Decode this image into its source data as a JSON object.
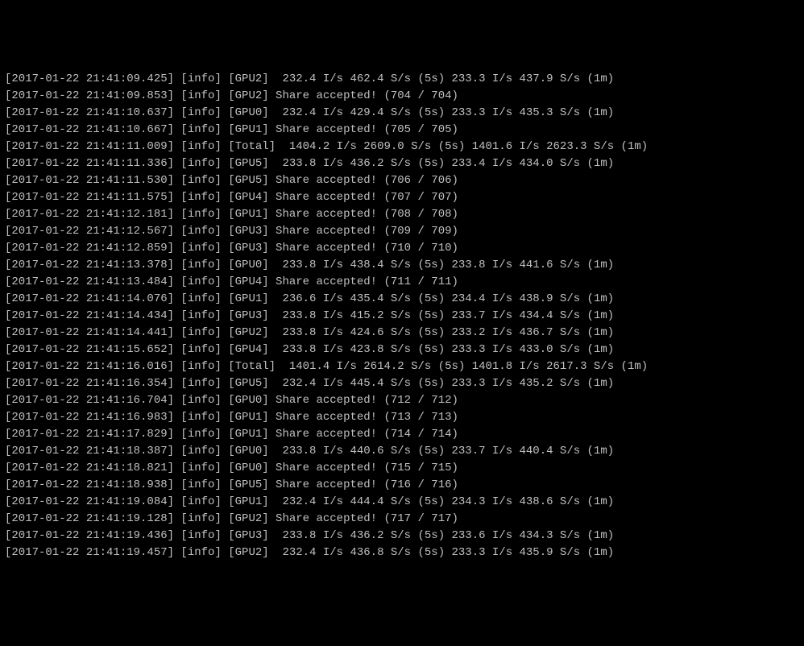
{
  "lines": [
    "[2017-01-22 21:41:09.425] [info] [GPU2]  232.4 I/s 462.4 S/s (5s) 233.3 I/s 437.9 S/s (1m)",
    "[2017-01-22 21:41:09.853] [info] [GPU2] Share accepted! (704 / 704)",
    "[2017-01-22 21:41:10.637] [info] [GPU0]  232.4 I/s 429.4 S/s (5s) 233.3 I/s 435.3 S/s (1m)",
    "[2017-01-22 21:41:10.667] [info] [GPU1] Share accepted! (705 / 705)",
    "[2017-01-22 21:41:11.009] [info] [Total]  1404.2 I/s 2609.0 S/s (5s) 1401.6 I/s 2623.3 S/s (1m)",
    "[2017-01-22 21:41:11.336] [info] [GPU5]  233.8 I/s 436.2 S/s (5s) 233.4 I/s 434.0 S/s (1m)",
    "[2017-01-22 21:41:11.530] [info] [GPU5] Share accepted! (706 / 706)",
    "[2017-01-22 21:41:11.575] [info] [GPU4] Share accepted! (707 / 707)",
    "[2017-01-22 21:41:12.181] [info] [GPU1] Share accepted! (708 / 708)",
    "[2017-01-22 21:41:12.567] [info] [GPU3] Share accepted! (709 / 709)",
    "[2017-01-22 21:41:12.859] [info] [GPU3] Share accepted! (710 / 710)",
    "[2017-01-22 21:41:13.378] [info] [GPU0]  233.8 I/s 438.4 S/s (5s) 233.8 I/s 441.6 S/s (1m)",
    "[2017-01-22 21:41:13.484] [info] [GPU4] Share accepted! (711 / 711)",
    "[2017-01-22 21:41:14.076] [info] [GPU1]  236.6 I/s 435.4 S/s (5s) 234.4 I/s 438.9 S/s (1m)",
    "[2017-01-22 21:41:14.434] [info] [GPU3]  233.8 I/s 415.2 S/s (5s) 233.7 I/s 434.4 S/s (1m)",
    "[2017-01-22 21:41:14.441] [info] [GPU2]  233.8 I/s 424.6 S/s (5s) 233.2 I/s 436.7 S/s (1m)",
    "[2017-01-22 21:41:15.652] [info] [GPU4]  233.8 I/s 423.8 S/s (5s) 233.3 I/s 433.0 S/s (1m)",
    "[2017-01-22 21:41:16.016] [info] [Total]  1401.4 I/s 2614.2 S/s (5s) 1401.8 I/s 2617.3 S/s (1m)",
    "[2017-01-22 21:41:16.354] [info] [GPU5]  232.4 I/s 445.4 S/s (5s) 233.3 I/s 435.2 S/s (1m)",
    "[2017-01-22 21:41:16.704] [info] [GPU0] Share accepted! (712 / 712)",
    "[2017-01-22 21:41:16.983] [info] [GPU1] Share accepted! (713 / 713)",
    "[2017-01-22 21:41:17.829] [info] [GPU1] Share accepted! (714 / 714)",
    "[2017-01-22 21:41:18.387] [info] [GPU0]  233.8 I/s 440.6 S/s (5s) 233.7 I/s 440.4 S/s (1m)",
    "[2017-01-22 21:41:18.821] [info] [GPU0] Share accepted! (715 / 715)",
    "[2017-01-22 21:41:18.938] [info] [GPU5] Share accepted! (716 / 716)",
    "[2017-01-22 21:41:19.084] [info] [GPU1]  232.4 I/s 444.4 S/s (5s) 234.3 I/s 438.6 S/s (1m)",
    "[2017-01-22 21:41:19.128] [info] [GPU2] Share accepted! (717 / 717)",
    "[2017-01-22 21:41:19.436] [info] [GPU3]  233.8 I/s 436.2 S/s (5s) 233.6 I/s 434.3 S/s (1m)",
    "[2017-01-22 21:41:19.457] [info] [GPU2]  232.4 I/s 436.8 S/s (5s) 233.3 I/s 435.9 S/s (1m)"
  ]
}
